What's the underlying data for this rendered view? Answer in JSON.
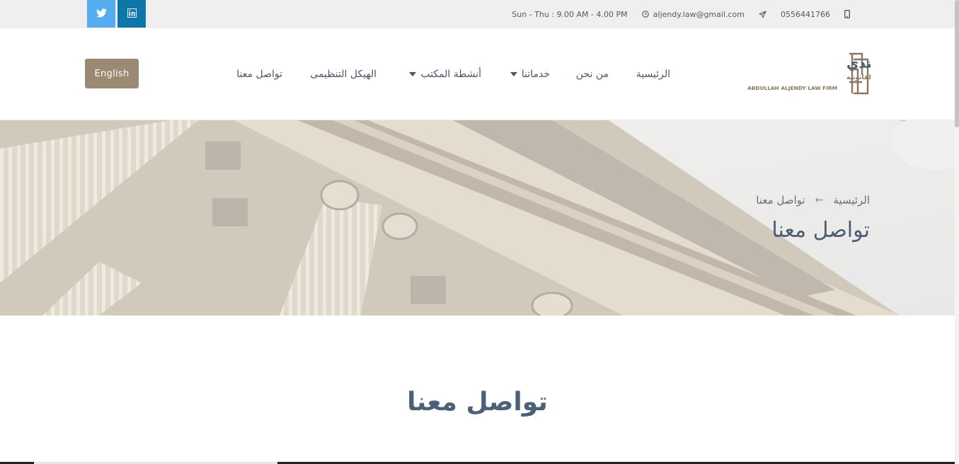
{
  "topbar": {
    "hours": "Sun - Thu : 9.00 AM - 4.00 PM",
    "email": "aljendy.law@gmail.com",
    "phone": "0556441766",
    "social": [
      {
        "name": "twitter",
        "icon": "twitter-icon",
        "color": "#55acee"
      },
      {
        "name": "linkedin",
        "icon": "linkedin-icon",
        "color": "#0e76a8"
      }
    ]
  },
  "header": {
    "lang_button": "English",
    "logo": {
      "arabic_name": "عبدالله الجندي",
      "arabic_sub": "للمحاماة والاستشارات القانونية",
      "english_name": "ABDULLAH ALJENDY LAW FIRM"
    },
    "nav": [
      {
        "label": "الرئيسية"
      },
      {
        "label": "من نحن"
      },
      {
        "label": "خدماتنا"
      },
      {
        "label": "أنشطة المكتب"
      },
      {
        "label": "الهيكل التنظيمى"
      },
      {
        "label": "تواصل معنا"
      }
    ]
  },
  "hero": {
    "breadcrumb": {
      "home": "الرئيسية",
      "arrow": "←",
      "current": "تواصل معنا"
    },
    "title": "تواصل معنا"
  },
  "main": {
    "section_title": "تواصل معنا"
  },
  "colors": {
    "accent": "#9a8a74",
    "text": "#4d6079",
    "topbar_bg": "#efefef"
  }
}
